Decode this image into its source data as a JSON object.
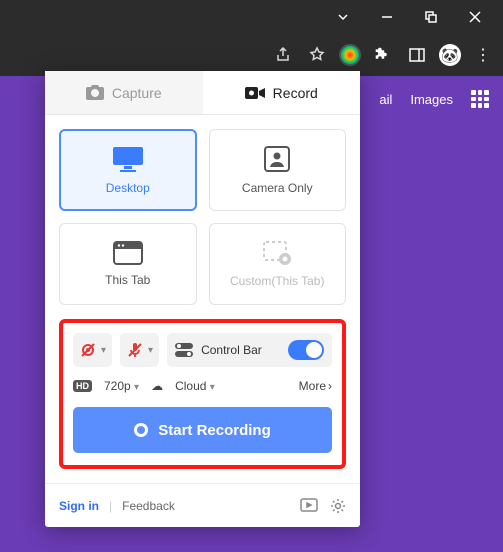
{
  "page": {
    "nav_mail": "ail",
    "nav_images": "Images"
  },
  "tabs": {
    "capture": "Capture",
    "record": "Record"
  },
  "modes": {
    "desktop": "Desktop",
    "camera": "Camera Only",
    "thistab": "This Tab",
    "custom": "Custom(This Tab)"
  },
  "controls": {
    "control_bar": "Control Bar",
    "quality": "720p",
    "storage": "Cloud",
    "more": "More"
  },
  "cta": {
    "start": "Start Recording"
  },
  "footer": {
    "signin": "Sign in",
    "feedback": "Feedback"
  }
}
